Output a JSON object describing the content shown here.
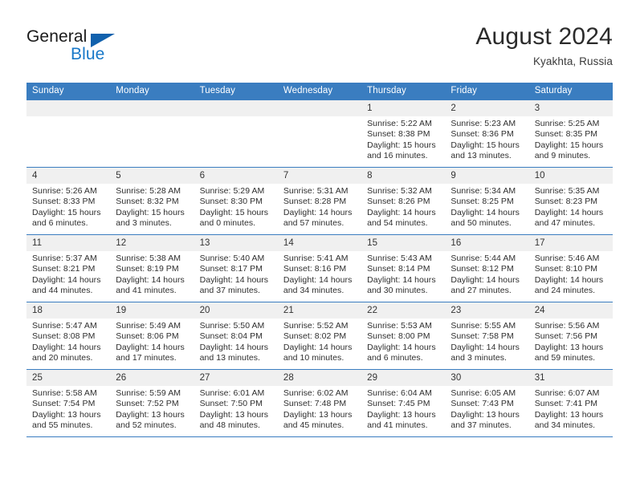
{
  "brand": {
    "name_top": "General",
    "name_bottom": "Blue",
    "logo_icon": "triangle-flag-icon",
    "accent_color": "#1878c8",
    "triangle_color": "#1161ad"
  },
  "header": {
    "title": "August 2024",
    "subtitle": "Kyakhta, Russia"
  },
  "theme": {
    "header_row_color": "#3a7dc0",
    "day_header_bg": "#f0f0f0",
    "grid_line_color": "#3a7dc0"
  },
  "weekday_headers": [
    "Sunday",
    "Monday",
    "Tuesday",
    "Wednesday",
    "Thursday",
    "Friday",
    "Saturday"
  ],
  "labels": {
    "sunrise_prefix": "Sunrise:",
    "sunset_prefix": "Sunset:",
    "daylight_prefix": "Daylight:"
  },
  "weeks": [
    [
      {
        "day": "",
        "empty": true,
        "sunrise": "",
        "sunset": "",
        "daylight": ""
      },
      {
        "day": "",
        "empty": true,
        "sunrise": "",
        "sunset": "",
        "daylight": ""
      },
      {
        "day": "",
        "empty": true,
        "sunrise": "",
        "sunset": "",
        "daylight": ""
      },
      {
        "day": "",
        "empty": true,
        "sunrise": "",
        "sunset": "",
        "daylight": ""
      },
      {
        "day": "1",
        "empty": false,
        "sunrise": "Sunrise: 5:22 AM",
        "sunset": "Sunset: 8:38 PM",
        "daylight": "Daylight: 15 hours and 16 minutes."
      },
      {
        "day": "2",
        "empty": false,
        "sunrise": "Sunrise: 5:23 AM",
        "sunset": "Sunset: 8:36 PM",
        "daylight": "Daylight: 15 hours and 13 minutes."
      },
      {
        "day": "3",
        "empty": false,
        "sunrise": "Sunrise: 5:25 AM",
        "sunset": "Sunset: 8:35 PM",
        "daylight": "Daylight: 15 hours and 9 minutes."
      }
    ],
    [
      {
        "day": "4",
        "empty": false,
        "sunrise": "Sunrise: 5:26 AM",
        "sunset": "Sunset: 8:33 PM",
        "daylight": "Daylight: 15 hours and 6 minutes."
      },
      {
        "day": "5",
        "empty": false,
        "sunrise": "Sunrise: 5:28 AM",
        "sunset": "Sunset: 8:32 PM",
        "daylight": "Daylight: 15 hours and 3 minutes."
      },
      {
        "day": "6",
        "empty": false,
        "sunrise": "Sunrise: 5:29 AM",
        "sunset": "Sunset: 8:30 PM",
        "daylight": "Daylight: 15 hours and 0 minutes."
      },
      {
        "day": "7",
        "empty": false,
        "sunrise": "Sunrise: 5:31 AM",
        "sunset": "Sunset: 8:28 PM",
        "daylight": "Daylight: 14 hours and 57 minutes."
      },
      {
        "day": "8",
        "empty": false,
        "sunrise": "Sunrise: 5:32 AM",
        "sunset": "Sunset: 8:26 PM",
        "daylight": "Daylight: 14 hours and 54 minutes."
      },
      {
        "day": "9",
        "empty": false,
        "sunrise": "Sunrise: 5:34 AM",
        "sunset": "Sunset: 8:25 PM",
        "daylight": "Daylight: 14 hours and 50 minutes."
      },
      {
        "day": "10",
        "empty": false,
        "sunrise": "Sunrise: 5:35 AM",
        "sunset": "Sunset: 8:23 PM",
        "daylight": "Daylight: 14 hours and 47 minutes."
      }
    ],
    [
      {
        "day": "11",
        "empty": false,
        "sunrise": "Sunrise: 5:37 AM",
        "sunset": "Sunset: 8:21 PM",
        "daylight": "Daylight: 14 hours and 44 minutes."
      },
      {
        "day": "12",
        "empty": false,
        "sunrise": "Sunrise: 5:38 AM",
        "sunset": "Sunset: 8:19 PM",
        "daylight": "Daylight: 14 hours and 41 minutes."
      },
      {
        "day": "13",
        "empty": false,
        "sunrise": "Sunrise: 5:40 AM",
        "sunset": "Sunset: 8:17 PM",
        "daylight": "Daylight: 14 hours and 37 minutes."
      },
      {
        "day": "14",
        "empty": false,
        "sunrise": "Sunrise: 5:41 AM",
        "sunset": "Sunset: 8:16 PM",
        "daylight": "Daylight: 14 hours and 34 minutes."
      },
      {
        "day": "15",
        "empty": false,
        "sunrise": "Sunrise: 5:43 AM",
        "sunset": "Sunset: 8:14 PM",
        "daylight": "Daylight: 14 hours and 30 minutes."
      },
      {
        "day": "16",
        "empty": false,
        "sunrise": "Sunrise: 5:44 AM",
        "sunset": "Sunset: 8:12 PM",
        "daylight": "Daylight: 14 hours and 27 minutes."
      },
      {
        "day": "17",
        "empty": false,
        "sunrise": "Sunrise: 5:46 AM",
        "sunset": "Sunset: 8:10 PM",
        "daylight": "Daylight: 14 hours and 24 minutes."
      }
    ],
    [
      {
        "day": "18",
        "empty": false,
        "sunrise": "Sunrise: 5:47 AM",
        "sunset": "Sunset: 8:08 PM",
        "daylight": "Daylight: 14 hours and 20 minutes."
      },
      {
        "day": "19",
        "empty": false,
        "sunrise": "Sunrise: 5:49 AM",
        "sunset": "Sunset: 8:06 PM",
        "daylight": "Daylight: 14 hours and 17 minutes."
      },
      {
        "day": "20",
        "empty": false,
        "sunrise": "Sunrise: 5:50 AM",
        "sunset": "Sunset: 8:04 PM",
        "daylight": "Daylight: 14 hours and 13 minutes."
      },
      {
        "day": "21",
        "empty": false,
        "sunrise": "Sunrise: 5:52 AM",
        "sunset": "Sunset: 8:02 PM",
        "daylight": "Daylight: 14 hours and 10 minutes."
      },
      {
        "day": "22",
        "empty": false,
        "sunrise": "Sunrise: 5:53 AM",
        "sunset": "Sunset: 8:00 PM",
        "daylight": "Daylight: 14 hours and 6 minutes."
      },
      {
        "day": "23",
        "empty": false,
        "sunrise": "Sunrise: 5:55 AM",
        "sunset": "Sunset: 7:58 PM",
        "daylight": "Daylight: 14 hours and 3 minutes."
      },
      {
        "day": "24",
        "empty": false,
        "sunrise": "Sunrise: 5:56 AM",
        "sunset": "Sunset: 7:56 PM",
        "daylight": "Daylight: 13 hours and 59 minutes."
      }
    ],
    [
      {
        "day": "25",
        "empty": false,
        "sunrise": "Sunrise: 5:58 AM",
        "sunset": "Sunset: 7:54 PM",
        "daylight": "Daylight: 13 hours and 55 minutes."
      },
      {
        "day": "26",
        "empty": false,
        "sunrise": "Sunrise: 5:59 AM",
        "sunset": "Sunset: 7:52 PM",
        "daylight": "Daylight: 13 hours and 52 minutes."
      },
      {
        "day": "27",
        "empty": false,
        "sunrise": "Sunrise: 6:01 AM",
        "sunset": "Sunset: 7:50 PM",
        "daylight": "Daylight: 13 hours and 48 minutes."
      },
      {
        "day": "28",
        "empty": false,
        "sunrise": "Sunrise: 6:02 AM",
        "sunset": "Sunset: 7:48 PM",
        "daylight": "Daylight: 13 hours and 45 minutes."
      },
      {
        "day": "29",
        "empty": false,
        "sunrise": "Sunrise: 6:04 AM",
        "sunset": "Sunset: 7:45 PM",
        "daylight": "Daylight: 13 hours and 41 minutes."
      },
      {
        "day": "30",
        "empty": false,
        "sunrise": "Sunrise: 6:05 AM",
        "sunset": "Sunset: 7:43 PM",
        "daylight": "Daylight: 13 hours and 37 minutes."
      },
      {
        "day": "31",
        "empty": false,
        "sunrise": "Sunrise: 6:07 AM",
        "sunset": "Sunset: 7:41 PM",
        "daylight": "Daylight: 13 hours and 34 minutes."
      }
    ]
  ]
}
